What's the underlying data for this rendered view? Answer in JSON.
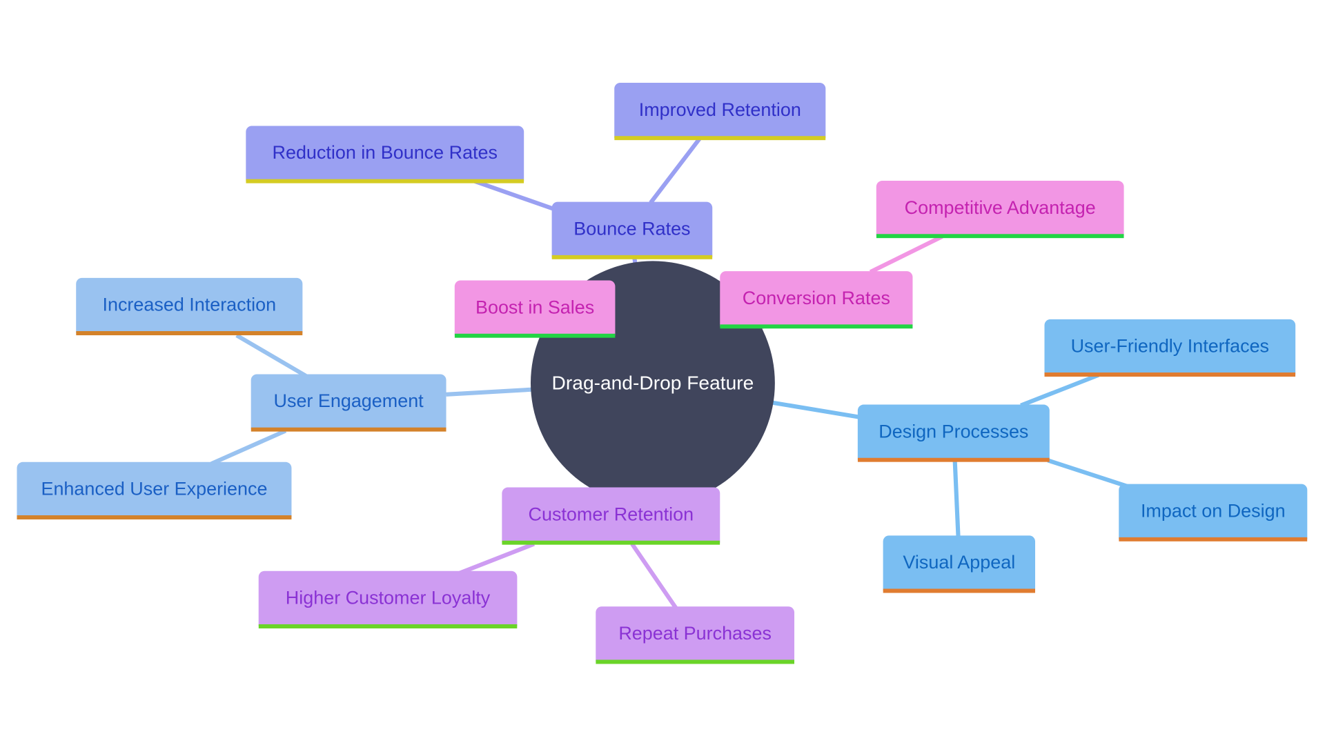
{
  "diagram": {
    "type": "mindmap",
    "root": {
      "label": "Drag-and-Drop Feature",
      "color": "#40455c"
    },
    "branches": [
      {
        "label": "Bounce Rates",
        "color": "#9aa0f2",
        "children": [
          "Reduction in Bounce Rates",
          "Improved Retention"
        ]
      },
      {
        "label": "Conversion Rates",
        "color": "#f296e4",
        "children": [
          "Competitive Advantage",
          "Boost in Sales"
        ]
      },
      {
        "label": "User Engagement",
        "color": "#99c2f0",
        "children": [
          "Increased Interaction",
          "Enhanced User Experience"
        ]
      },
      {
        "label": "Design Processes",
        "color": "#7abef2",
        "children": [
          "User-Friendly Interfaces",
          "Impact on Design",
          "Visual Appeal"
        ]
      },
      {
        "label": "Customer Retention",
        "color": "#ce9cf2",
        "children": [
          "Higher Customer Loyalty",
          "Repeat Purchases"
        ]
      }
    ]
  }
}
